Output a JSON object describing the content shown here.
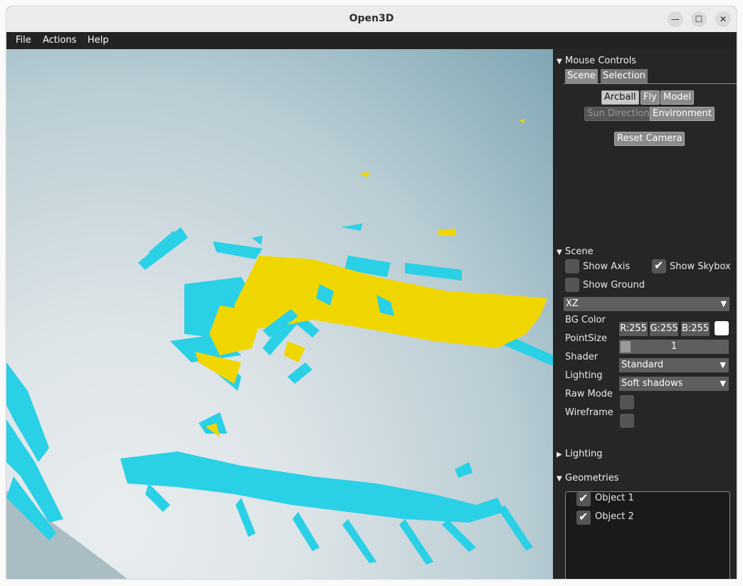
{
  "window": {
    "title": "Open3D"
  },
  "menu": [
    "File",
    "Actions",
    "Help"
  ],
  "mouse_controls": {
    "header": "Mouse Controls",
    "tabs": [
      "Scene",
      "Selection"
    ],
    "modes": [
      "Arcball",
      "Fly",
      "Model"
    ],
    "modes2": [
      "Sun Direction",
      "Environment"
    ],
    "reset": "Reset Camera"
  },
  "scene": {
    "header": "Scene",
    "show_axis": "Show Axis",
    "show_skybox": "Show Skybox",
    "show_ground": "Show Ground",
    "plane": "XZ",
    "bg_color_label": "BG Color",
    "bg_r": "R:255",
    "bg_g": "G:255",
    "bg_b": "B:255",
    "point_size_label": "PointSize",
    "point_size": "1",
    "shader_label": "Shader",
    "shader": "Standard",
    "lighting_label": "Lighting",
    "lighting": "Soft shadows",
    "raw_mode": "Raw Mode",
    "wireframe": "Wireframe"
  },
  "lighting_section": {
    "header": "Lighting"
  },
  "geometries": {
    "header": "Geometries",
    "items": [
      "Object 1",
      "Object 2"
    ]
  },
  "colors": {
    "point_cyan": "#29d0e6",
    "point_yellow": "#f0d600"
  }
}
